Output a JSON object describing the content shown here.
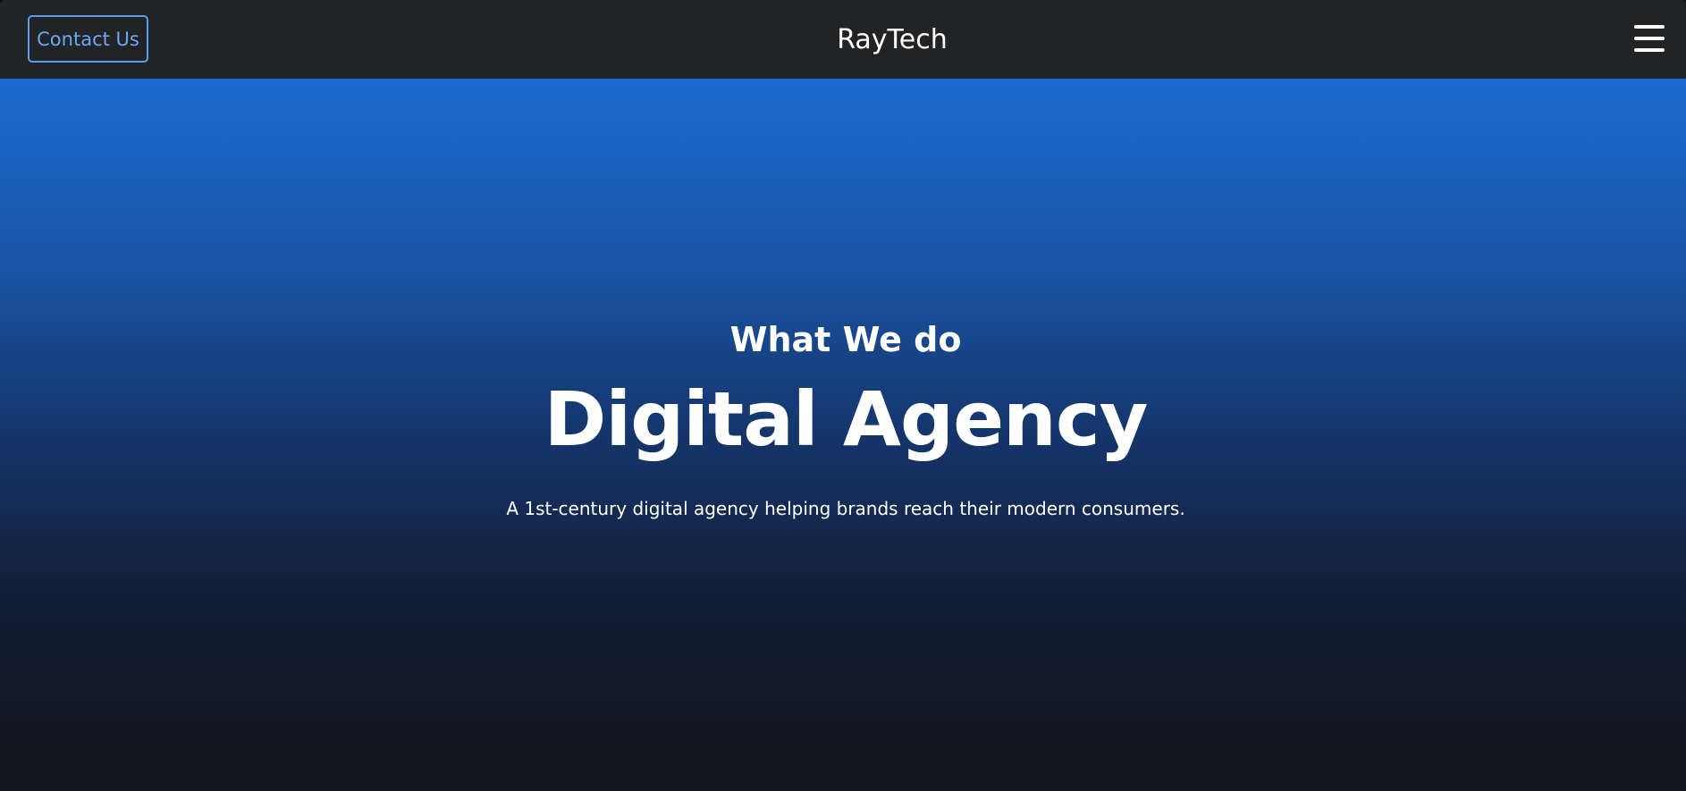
{
  "header": {
    "contact_label": "Contact Us",
    "brand": "RayTech",
    "menu_icon": "hamburger-menu-icon"
  },
  "hero": {
    "kicker": "What We do",
    "title": "Digital Agency",
    "subtitle": "A 1st-century digital agency helping brands reach their modern consumers."
  },
  "colors": {
    "navbar_bg": "#222325",
    "accent": "#5b9bf2",
    "gradient_top": "#1b6ad0",
    "gradient_bottom": "#111418",
    "text": "#ffffff"
  }
}
